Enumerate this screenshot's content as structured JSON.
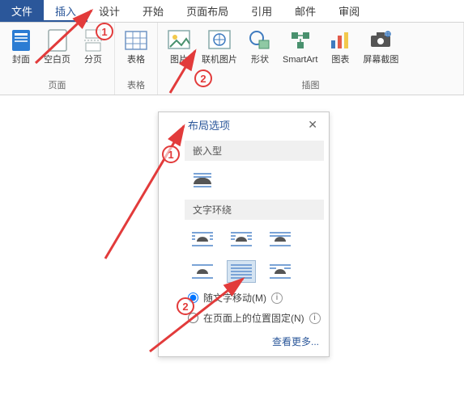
{
  "tabs": {
    "file": "文件",
    "insert": "插入",
    "design": "设计",
    "home": "开始",
    "pagelayout": "页面布局",
    "references": "引用",
    "mail": "邮件",
    "review": "审阅"
  },
  "groups": {
    "pages": {
      "label": "页面",
      "cover": "封面",
      "blank": "空白页",
      "break": "分页"
    },
    "tables": {
      "label": "表格",
      "table": "表格"
    },
    "illustrations": {
      "label": "插图",
      "picture": "图片",
      "online": "联机图片",
      "shapes": "形状",
      "smartart": "SmartArt",
      "chart": "图表",
      "screenshot": "屏幕截图"
    }
  },
  "popout": {
    "title": "布局选项",
    "sec_inline": "嵌入型",
    "sec_wrap": "文字环绕",
    "radio_move": "随文字移动(M)",
    "radio_fix": "在页面上的位置固定(N)",
    "see_more": "查看更多...",
    "close": "✕"
  },
  "callouts": {
    "c1": "1",
    "c2": "2"
  }
}
